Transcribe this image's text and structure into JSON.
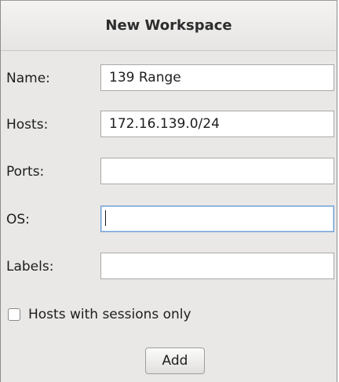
{
  "dialog": {
    "title": "New Workspace"
  },
  "form": {
    "name": {
      "label": "Name:",
      "value": "139 Range",
      "placeholder": ""
    },
    "hosts": {
      "label": "Hosts:",
      "value": "172.16.139.0/24",
      "placeholder": ""
    },
    "ports": {
      "label": "Ports:",
      "value": "",
      "placeholder": ""
    },
    "os": {
      "label": "OS:",
      "value": "",
      "placeholder": ""
    },
    "labels": {
      "label": "Labels:",
      "value": "",
      "placeholder": ""
    },
    "sessions_only": {
      "label": "Hosts with sessions only",
      "checked": false
    }
  },
  "buttons": {
    "add_label": "Add"
  },
  "colors": {
    "background": "#e9e8e7",
    "focus_border": "#6d9bd3"
  }
}
